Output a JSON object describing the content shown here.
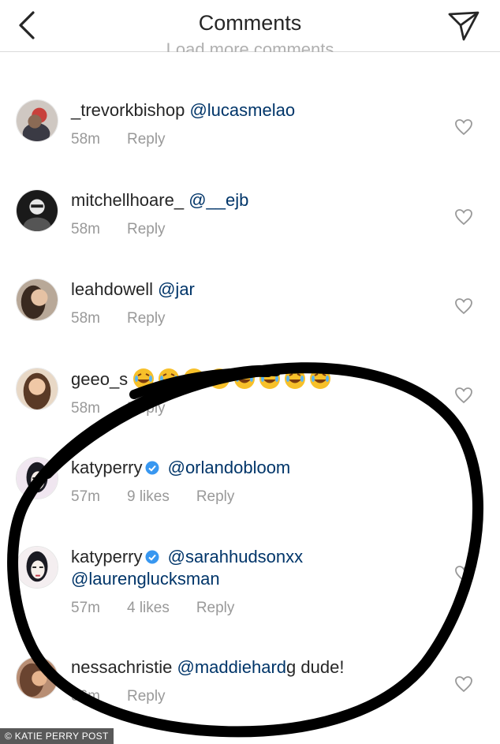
{
  "header": {
    "title": "Comments",
    "back_icon": "chevron-left-icon",
    "send_icon": "paper-plane-icon"
  },
  "load_more": "Load more comments",
  "comments": [
    {
      "username": "_trevorkbishop",
      "text": "@lucasmelao",
      "time": "58m",
      "likes": "",
      "reply": "Reply"
    },
    {
      "username": "mitchellhoare_",
      "text": "@__ejb",
      "time": "58m",
      "likes": "",
      "reply": "Reply"
    },
    {
      "username": "leahdowell",
      "text": "@jar",
      "time": "58m",
      "likes": "",
      "reply": "Reply"
    },
    {
      "username": "geeo_s",
      "text": "",
      "time": "58m",
      "likes": "",
      "reply": "Reply"
    },
    {
      "username": "katyperry",
      "text": "@orlandobloom",
      "time": "57m",
      "likes": "9 likes",
      "reply": "Reply"
    },
    {
      "username": "katyperry",
      "text": "@sarahhudsonxx",
      "text2": "@laurenglucksman",
      "time": "57m",
      "likes": "4 likes",
      "reply": "Reply"
    },
    {
      "username": "nessachristie",
      "text": "@maddiehard",
      "text_tail": "g dude!",
      "time": "56m",
      "likes": "",
      "reply": "Reply"
    }
  ],
  "colors": {
    "mention": "#003569",
    "meta": "#999999",
    "verified": "#3897f0"
  },
  "credit": "© KATIE PERRY POST"
}
